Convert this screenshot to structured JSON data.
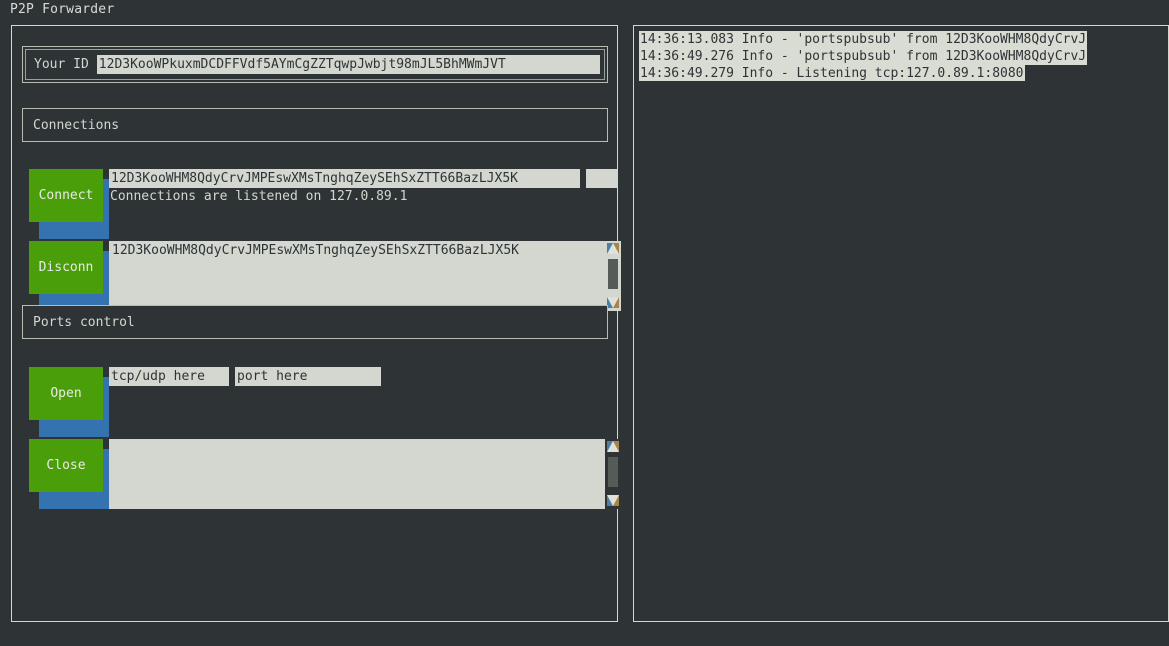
{
  "window": {
    "title": "P2P Forwarder"
  },
  "left_panel": {
    "your_id": {
      "label": "Your ID",
      "value": "12D3KooWPkuxmDCDFFVdf5AYmCgZZTqwpJwbjt98mJL5BhMWmJVT"
    },
    "connections": {
      "group_label": "Connections",
      "connect_button": "Connect",
      "disconnect_button": "Disconn",
      "peer_id_value": "12D3KooWHM8QdyCrvJMPEswXMsTnghqZeySEhSxZTT66BazLJX5K",
      "peer_extra_value": "",
      "status_text": "Connections are listened on 127.0.89.1",
      "list_items": [
        "12D3KooWHM8QdyCrvJMPEswXMsTnghqZeySEhSxZTT66BazLJX5K"
      ]
    },
    "ports": {
      "group_label": "Ports control",
      "open_button": "Open",
      "close_button": "Close",
      "protocol_placeholder": "tcp/udp here",
      "protocol_value": "",
      "port_placeholder": "port here",
      "port_value": "",
      "list_items": []
    }
  },
  "right_panel": {
    "log_lines": [
      "14:36:13.083 Info - 'portspubsub' from 12D3KooWHM8QdyCrvJ",
      "14:36:49.276 Info - 'portspubsub' from 12D3KooWHM8QdyCrvJ",
      "14:36:49.279 Info - Listening tcp:127.0.89.1:8080"
    ]
  },
  "colors": {
    "background": "#2e3436",
    "button_green": "#4a9e09",
    "button_shadow_blue": "#3572b0",
    "widget_light": "#d3d7cf",
    "text_light": "#d3d7cf",
    "border": "#b8bcb4"
  }
}
